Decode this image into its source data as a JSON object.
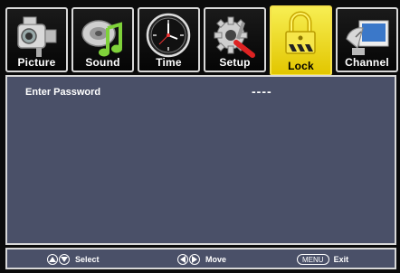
{
  "tabs": [
    {
      "label": "Picture",
      "icon": "camcorder-icon"
    },
    {
      "label": "Sound",
      "icon": "music-note-icon"
    },
    {
      "label": "Time",
      "icon": "clock-icon"
    },
    {
      "label": "Setup",
      "icon": "gear-wrench-icon"
    },
    {
      "label": "Lock",
      "icon": "padlock-icon",
      "selected": true
    },
    {
      "label": "Channel",
      "icon": "satellite-dish-icon"
    }
  ],
  "content": {
    "password_label": "Enter Password",
    "password_value": "----"
  },
  "status_bar": {
    "select_label": "Select",
    "move_label": "Move",
    "menu_key": "MENU",
    "exit_label": "Exit"
  },
  "colors": {
    "panel_bg": "#4a5068",
    "selected_tab": "#f0dc2a",
    "border": "#d8d8d8"
  }
}
